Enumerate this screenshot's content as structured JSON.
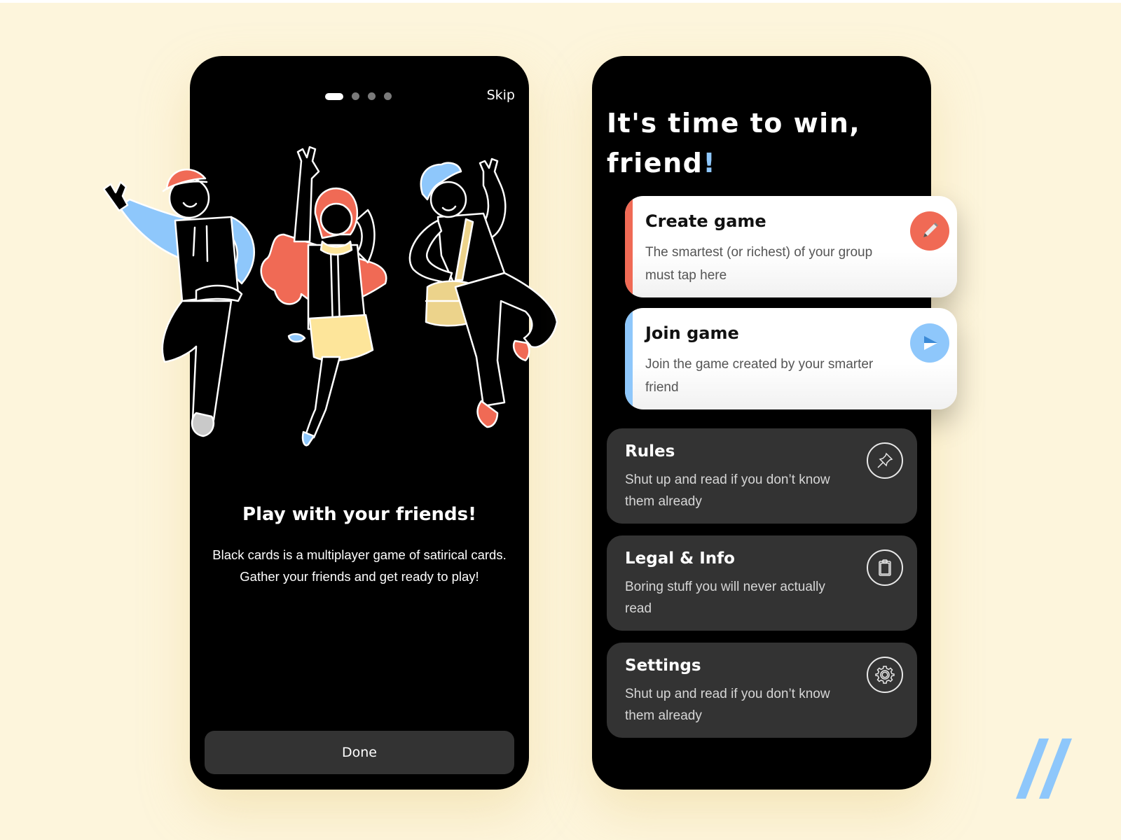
{
  "onboarding": {
    "pager": {
      "total": 4,
      "active_index": 0
    },
    "skip_label": "Skip",
    "title": "Play with your friends!",
    "body_line1": "Black cards is a multiplayer game of satirical cards.",
    "body_line2": "Gather your friends and get ready to play!",
    "done_label": "Done",
    "illustration": "three-jumping-friends-illustration"
  },
  "home": {
    "headline_line1": "It's time to win,",
    "headline_line2": "friend",
    "headline_punct": "!",
    "actions": [
      {
        "title": "Create game",
        "description": "The smartest (or richest) of your group must tap here",
        "icon": "pencil-icon",
        "accent": "#f06a55"
      },
      {
        "title": "Join game",
        "description": "Join the game created by your smarter friend",
        "icon": "send-icon",
        "accent": "#8ec7fb"
      }
    ],
    "menu": [
      {
        "title": "Rules",
        "description": "Shut up and read if you don’t know them already",
        "icon": "pushpin-icon"
      },
      {
        "title": "Legal & Info",
        "description": "Boring stuff you will never actually read",
        "icon": "clipboard-icon"
      },
      {
        "title": "Settings",
        "description": "Shut up and read if you don’t know them already",
        "icon": "gear-icon"
      }
    ]
  },
  "colors": {
    "background": "#fdf5dc",
    "red_accent": "#f06a55",
    "blue_accent": "#8ec7fb",
    "yellow_accent": "#fde59a",
    "card_dark": "#333333"
  }
}
